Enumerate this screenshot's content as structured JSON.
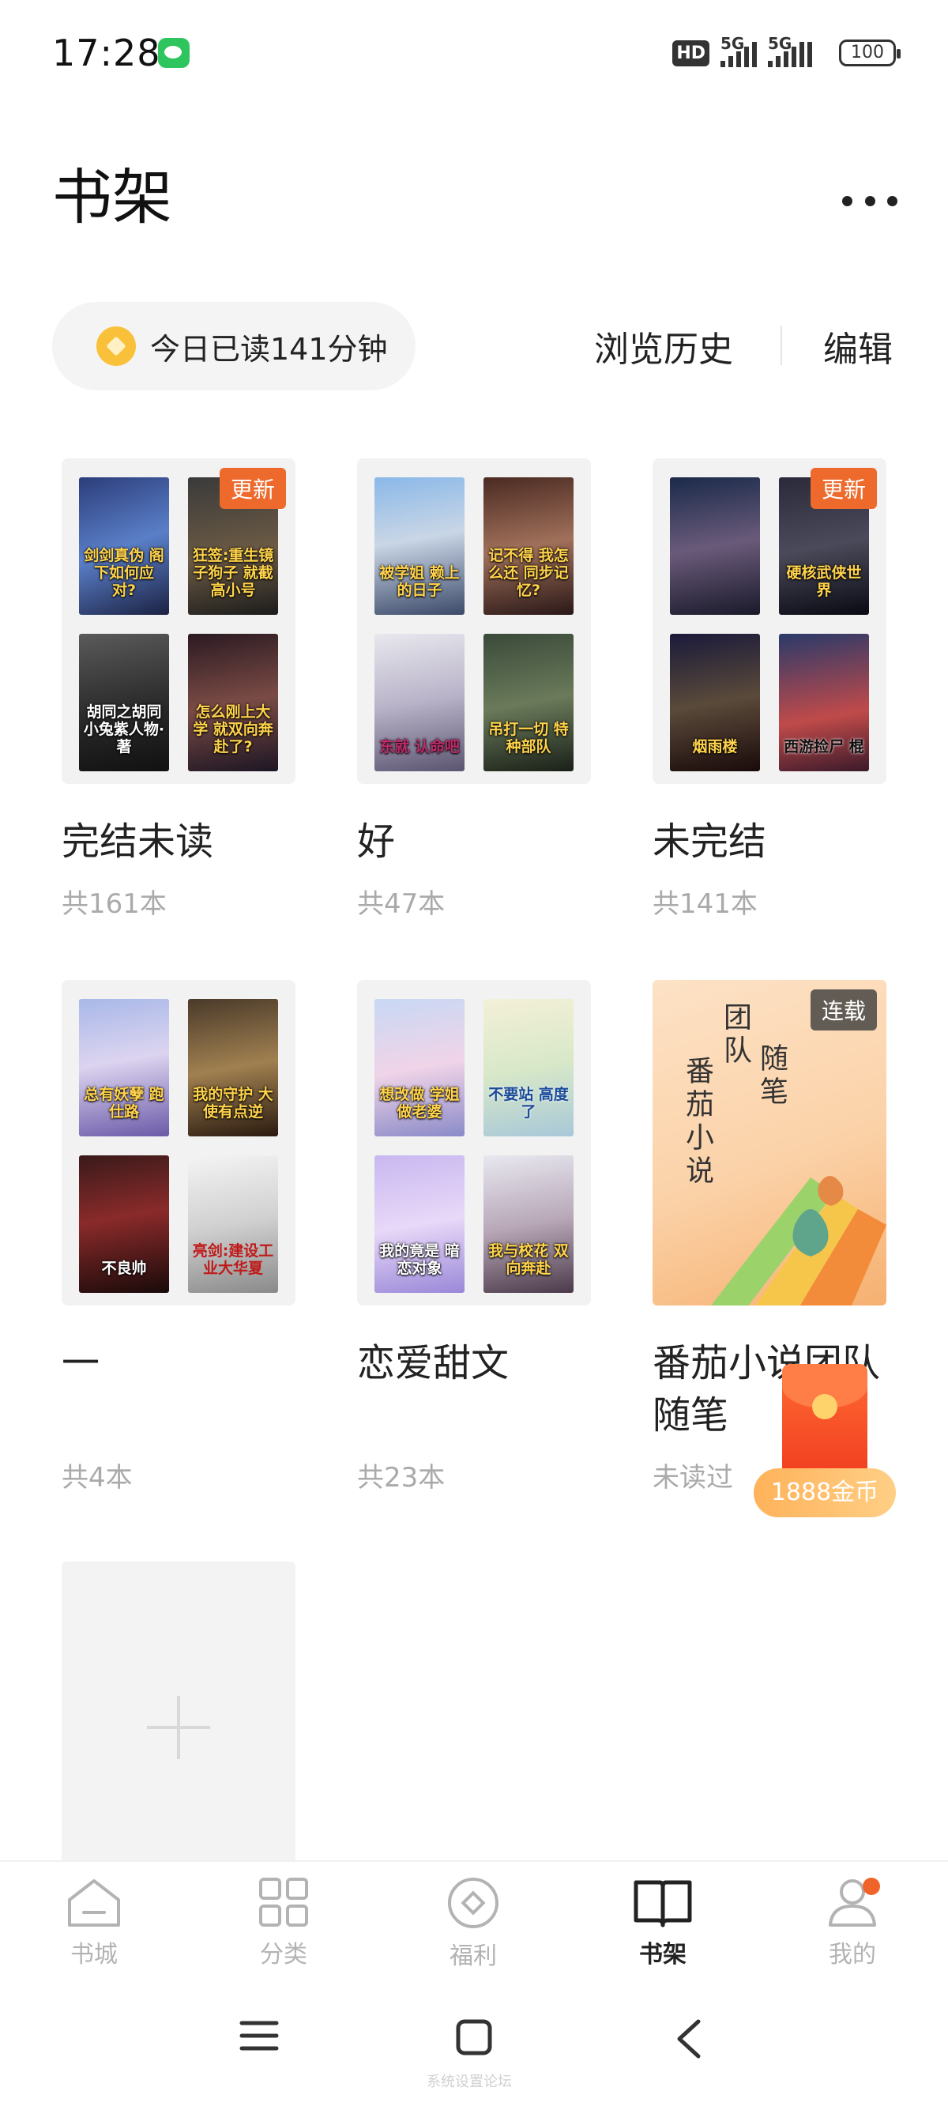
{
  "status_bar": {
    "time": "17:28",
    "hd": "HD",
    "net1": "5G",
    "net2": "5G",
    "battery": "100"
  },
  "header": {
    "title": "书架",
    "reading_time": "今日已读141分钟",
    "history_label": "浏览历史",
    "edit_label": "编辑"
  },
  "folders": [
    {
      "name": "完结未读",
      "count": "共161本",
      "badge": "更新",
      "covers": [
        "剑剑真伪 阁下如何应对?",
        "狂签:重生镜子狗子 就截高小号",
        "胡同之胡同 小兔紫人物·著",
        "怎么刚上大学 就双向奔赴了?"
      ]
    },
    {
      "name": "好",
      "count": "共47本",
      "covers": [
        "被学姐 赖上的日子",
        "记不得 我怎么还 同步记忆?",
        "东就 认命吧",
        "吊打一切 特种部队"
      ]
    },
    {
      "name": "未完结",
      "count": "共141本",
      "badge": "更新",
      "covers": [
        "",
        "硬核武侠世界",
        "烟雨楼",
        "西游捡尸 棍"
      ]
    },
    {
      "name": "一",
      "count": "共4本",
      "covers": [
        "总有妖孽 跑仕路",
        "我的守护 大使有点逆",
        "不良帅",
        "亮剑:建设工业大华夏"
      ]
    },
    {
      "name": "恋爱甜文",
      "count": "共23本",
      "covers": [
        "想改做 学姐做老婆",
        "不要站 高度了",
        "我的竟是 暗恋对象",
        "我与校花 双向奔赴"
      ]
    },
    {
      "name": "番茄小说团队随笔",
      "count": "未读过",
      "badge": "连载",
      "cover_text": [
        "团队",
        "随笔",
        "番茄小说"
      ]
    }
  ],
  "red_packet": {
    "label": "1888金币"
  },
  "bottom_nav": [
    {
      "label": "书城",
      "icon": "home-icon"
    },
    {
      "label": "分类",
      "icon": "category-grid-icon"
    },
    {
      "label": "福利",
      "icon": "welfare-icon"
    },
    {
      "label": "书架",
      "icon": "bookshelf-icon",
      "active": true
    },
    {
      "label": "我的",
      "icon": "profile-icon"
    }
  ],
  "watermark": "系统设置论坛",
  "colors": {
    "accent": "#ee6a2c",
    "text": "#222222",
    "muted": "#aaaaaa",
    "pill_bg": "#f4f4f4"
  }
}
